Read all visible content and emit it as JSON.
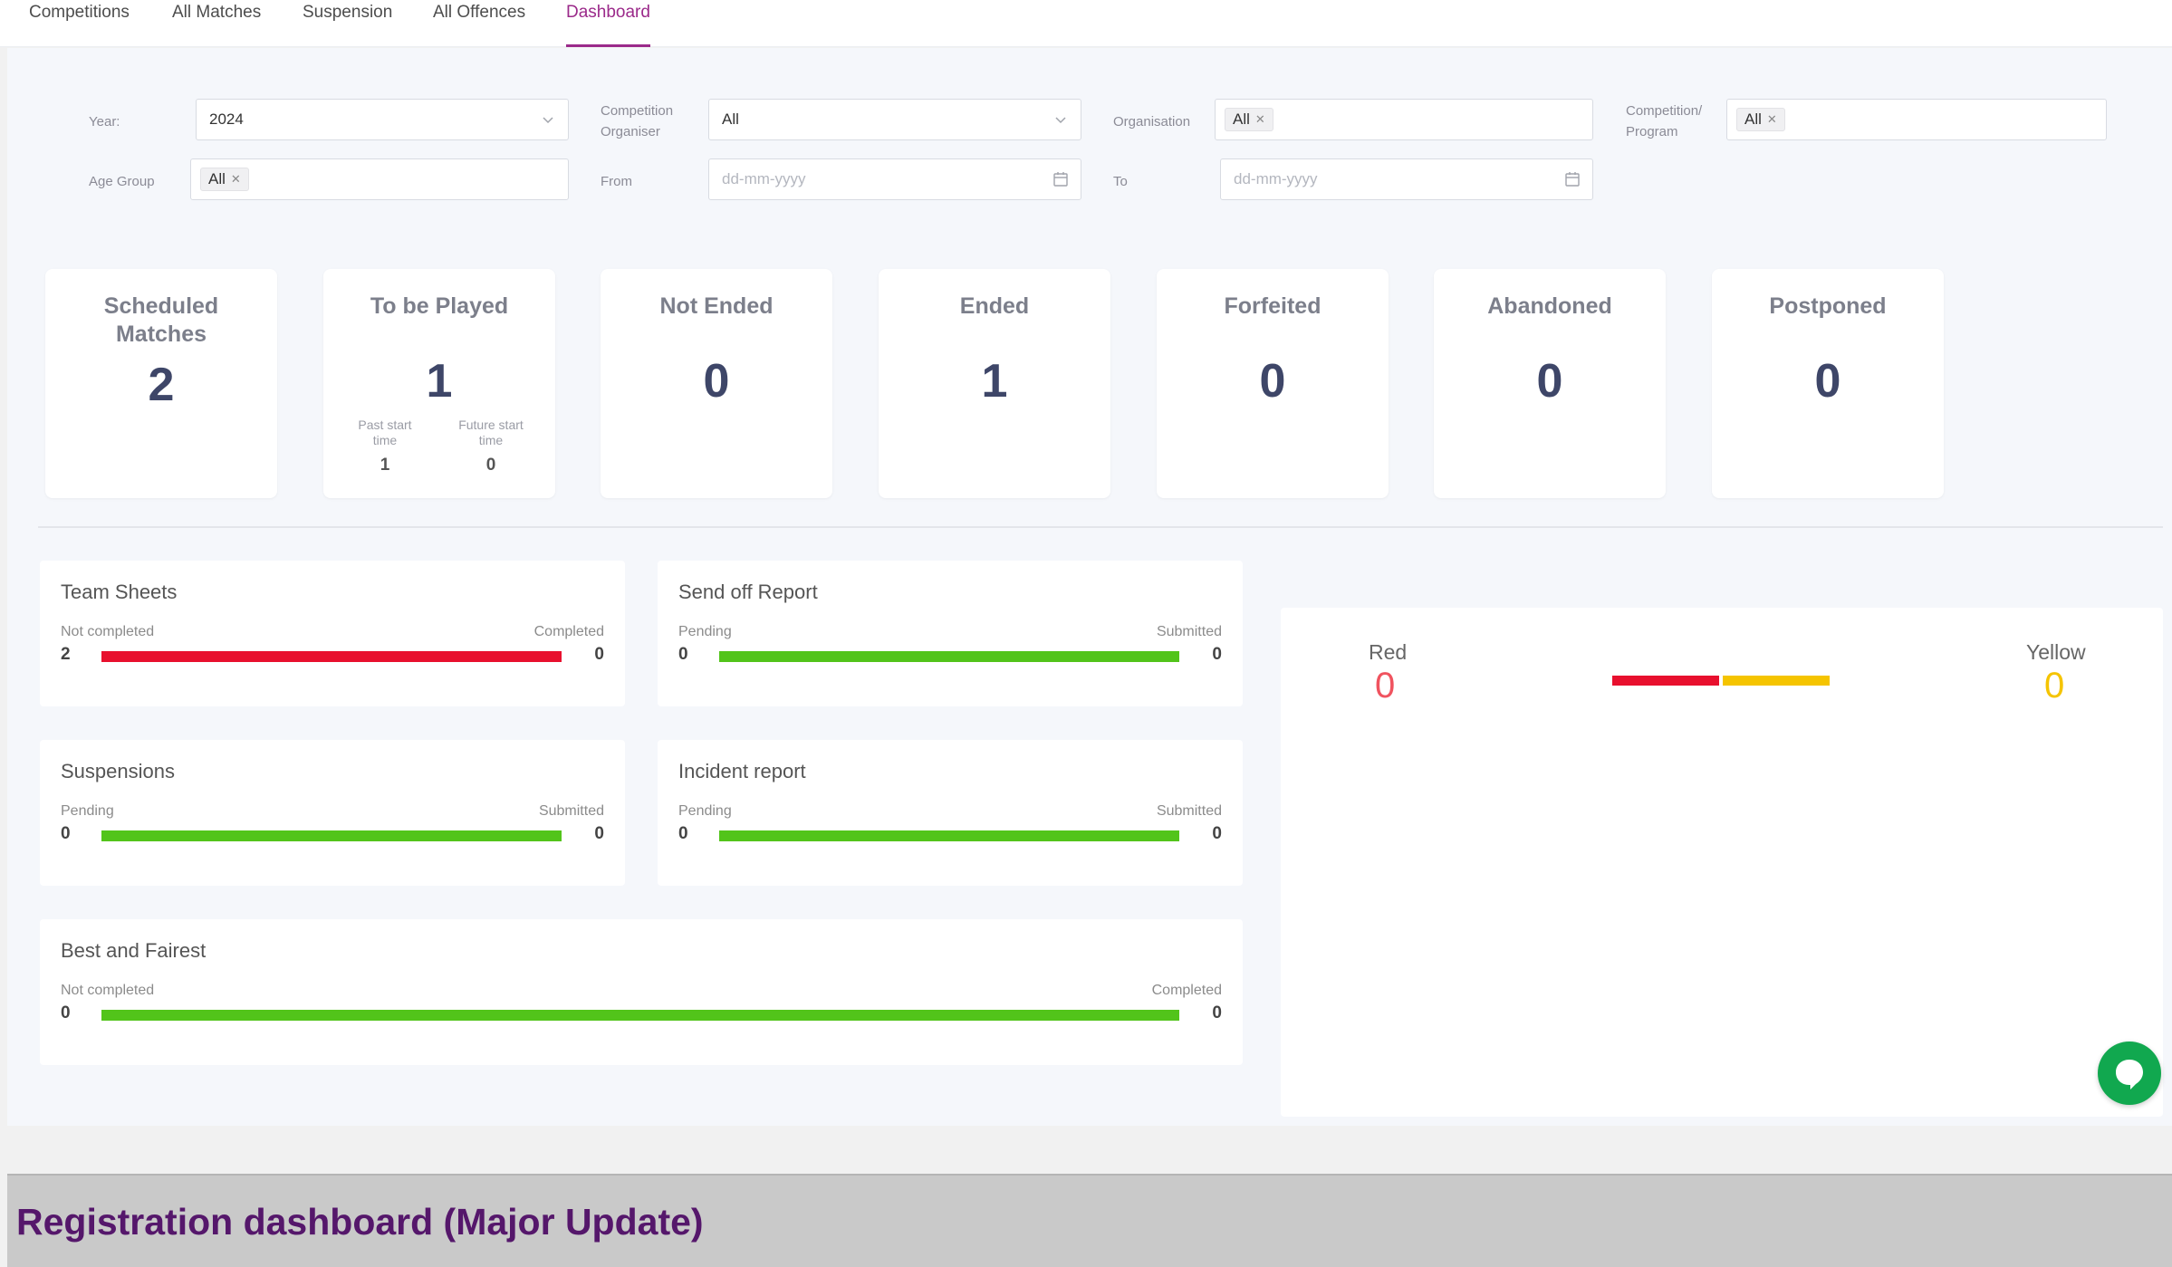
{
  "nav": {
    "tabs": [
      {
        "label": "Competitions"
      },
      {
        "label": "All Matches"
      },
      {
        "label": "Suspension"
      },
      {
        "label": "All Offences"
      },
      {
        "label": "Dashboard"
      }
    ],
    "active_tab": "Dashboard"
  },
  "filters": {
    "year": {
      "label": "Year:",
      "value": "2024"
    },
    "competition_organiser": {
      "label_line1": "Competition",
      "label_line2": "Organiser",
      "value": "All"
    },
    "organisation": {
      "label": "Organisation",
      "tag": "All"
    },
    "competition_program": {
      "label_line1": "Competition/",
      "label_line2": "Program",
      "tag": "All"
    },
    "age_group": {
      "label": "Age Group",
      "tag": "All"
    },
    "from": {
      "label": "From",
      "placeholder": "dd-mm-yyyy"
    },
    "to": {
      "label": "To",
      "placeholder": "dd-mm-yyyy"
    }
  },
  "stat_cards": [
    {
      "title": "Scheduled Matches",
      "value": "2"
    },
    {
      "title": "To be Played",
      "value": "1",
      "past_label": "Past start time",
      "past_value": "1",
      "future_label": "Future start time",
      "future_value": "0"
    },
    {
      "title": "Not Ended",
      "value": "0"
    },
    {
      "title": "Ended",
      "value": "1"
    },
    {
      "title": "Forfeited",
      "value": "0"
    },
    {
      "title": "Abandoned",
      "value": "0"
    },
    {
      "title": "Postponed",
      "value": "0"
    }
  ],
  "panels": {
    "team_sheets": {
      "title": "Team Sheets",
      "left_label": "Not completed",
      "right_label": "Completed",
      "left_value": "2",
      "right_value": "0",
      "color": "#e8102e"
    },
    "send_off": {
      "title": "Send off Report",
      "left_label": "Pending",
      "right_label": "Submitted",
      "left_value": "0",
      "right_value": "0",
      "color": "#52c41a"
    },
    "suspensions": {
      "title": "Suspensions",
      "left_label": "Pending",
      "right_label": "Submitted",
      "left_value": "0",
      "right_value": "0",
      "color": "#52c41a"
    },
    "incident": {
      "title": "Incident report",
      "left_label": "Pending",
      "right_label": "Submitted",
      "left_value": "0",
      "right_value": "0",
      "color": "#52c41a"
    },
    "best_fairest": {
      "title": "Best and Fairest",
      "left_label": "Not completed",
      "right_label": "Completed",
      "left_value": "0",
      "right_value": "0",
      "color": "#52c41a"
    }
  },
  "cards_panel": {
    "red_label": "Red",
    "red_value": "0",
    "red_color": "#f0535f",
    "yellow_label": "Yellow",
    "yellow_value": "0",
    "yellow_color": "#f5c400"
  },
  "footer": {
    "title": "Registration dashboard (Major Update)"
  }
}
